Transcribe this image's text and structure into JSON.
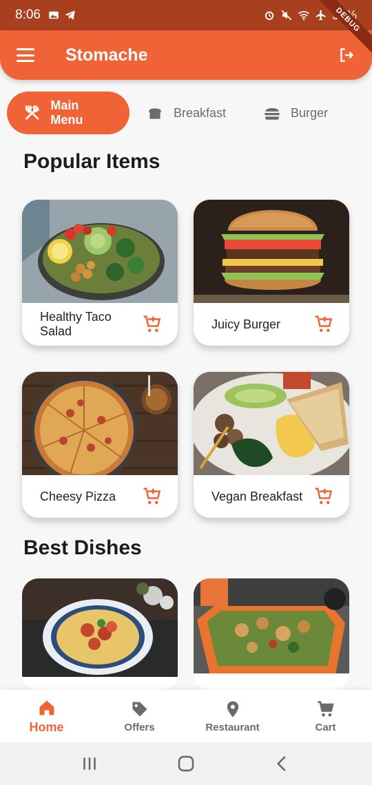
{
  "status_bar": {
    "time": "8:06",
    "battery": "30%",
    "debug": "DEBUG"
  },
  "app_bar": {
    "title": "Stomache"
  },
  "tabs": [
    {
      "label": "Main Menu",
      "icon": "restaurant-icon",
      "active": true
    },
    {
      "label": "Breakfast",
      "icon": "bread-icon",
      "active": false
    },
    {
      "label": "Burger",
      "icon": "burger-icon",
      "active": false
    }
  ],
  "sections": {
    "popular_title": "Popular Items",
    "best_title": "Best Dishes"
  },
  "popular_items": [
    {
      "name": "Healthy Taco Salad"
    },
    {
      "name": "Juicy Burger"
    },
    {
      "name": "Cheesy Pizza"
    },
    {
      "name": "Vegan Breakfast"
    }
  ],
  "bottom_nav": [
    {
      "label": "Home",
      "icon": "home-icon",
      "active": true
    },
    {
      "label": "Offers",
      "icon": "tag-icon",
      "active": false
    },
    {
      "label": "Restaurant",
      "icon": "location-pin-icon",
      "active": false
    },
    {
      "label": "Cart",
      "icon": "cart-icon",
      "active": false
    }
  ],
  "colors": {
    "accent": "#ef6336",
    "status_bar": "#a8401f",
    "background": "#f7f7f7"
  }
}
